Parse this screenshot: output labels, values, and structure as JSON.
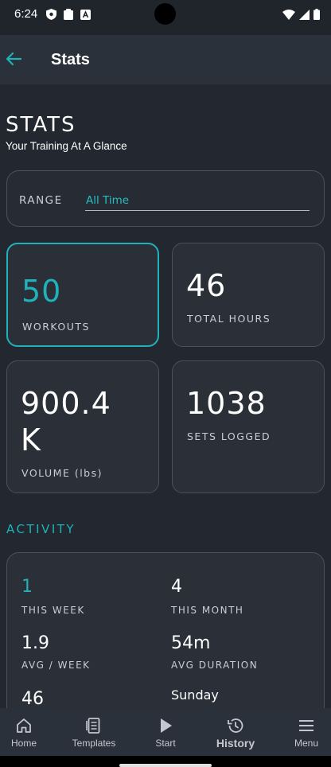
{
  "status_bar": {
    "time": "6:24"
  },
  "app_bar": {
    "title": "Stats"
  },
  "page": {
    "title": "STATS",
    "subtitle": "Your Training At A Glance"
  },
  "range": {
    "label": "RANGE",
    "value": "All Time"
  },
  "stats": [
    {
      "value": "50",
      "label": "WORKOUTS",
      "active": true
    },
    {
      "value": "46",
      "label": "TOTAL HOURS",
      "active": false
    },
    {
      "value": "900.4",
      "value_line2": "K",
      "label": "VOLUME (lbs)",
      "active": false
    },
    {
      "value": "1038",
      "label": "SETS LOGGED",
      "active": false
    }
  ],
  "activity": {
    "title": "ACTIVITY",
    "items": [
      {
        "value": "1",
        "label": "THIS WEEK"
      },
      {
        "value": "4",
        "label": "THIS MONTH"
      },
      {
        "value": "1.9",
        "label": "AVG / WEEK"
      },
      {
        "value": "54m",
        "label": "AVG DURATION"
      },
      {
        "value": "46",
        "label": ""
      },
      {
        "value": "Sunday",
        "label": ""
      }
    ]
  },
  "bottom_nav": {
    "items": [
      {
        "label": "Home",
        "icon": "home-icon"
      },
      {
        "label": "Templates",
        "icon": "templates-icon"
      },
      {
        "label": "Start",
        "icon": "play-icon"
      },
      {
        "label": "History",
        "icon": "history-icon",
        "active": true
      },
      {
        "label": "Menu",
        "icon": "menu-icon"
      }
    ]
  },
  "colors": {
    "accent": "#1fb2b8",
    "background": "#222730",
    "card": "#2a2f38"
  }
}
